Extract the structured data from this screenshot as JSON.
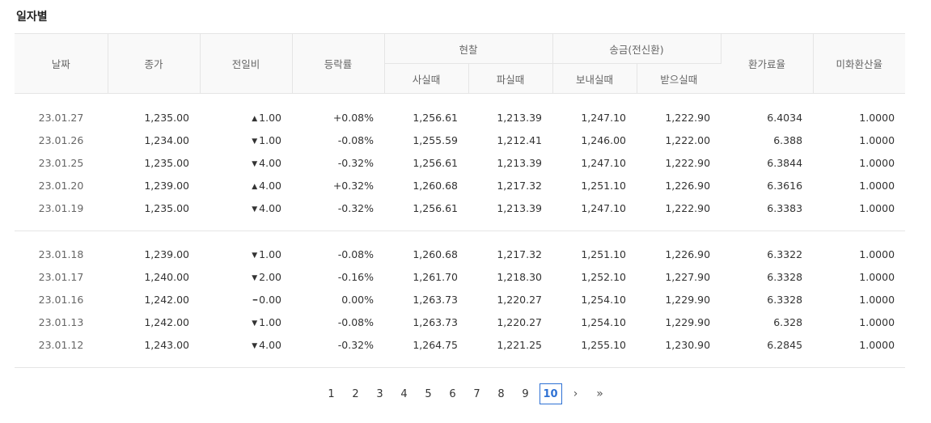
{
  "section_title": "일자별",
  "headers": {
    "date": "날짜",
    "close": "종가",
    "change": "전일비",
    "change_rate": "등락률",
    "cash_group": "현찰",
    "cash_buy": "사실때",
    "cash_sell": "파실때",
    "wire_group": "송금(전신환)",
    "wire_send": "보내실때",
    "wire_receive": "받으실때",
    "fx_rate": "환가료율",
    "usd_rate": "미화환산율"
  },
  "rows": [
    {
      "date": "23.01.27",
      "close": "1,235.00",
      "dir": "up",
      "arrow": "▲",
      "change": "1.00",
      "rate": "+0.08%",
      "cash_buy": "1,256.61",
      "cash_sell": "1,213.39",
      "wire_send": "1,247.10",
      "wire_receive": "1,222.90",
      "fx_rate": "6.4034",
      "usd_rate": "1.0000"
    },
    {
      "date": "23.01.26",
      "close": "1,234.00",
      "dir": "down",
      "arrow": "▼",
      "change": "1.00",
      "rate": "-0.08%",
      "cash_buy": "1,255.59",
      "cash_sell": "1,212.41",
      "wire_send": "1,246.00",
      "wire_receive": "1,222.00",
      "fx_rate": "6.388",
      "usd_rate": "1.0000"
    },
    {
      "date": "23.01.25",
      "close": "1,235.00",
      "dir": "down",
      "arrow": "▼",
      "change": "4.00",
      "rate": "-0.32%",
      "cash_buy": "1,256.61",
      "cash_sell": "1,213.39",
      "wire_send": "1,247.10",
      "wire_receive": "1,222.90",
      "fx_rate": "6.3844",
      "usd_rate": "1.0000"
    },
    {
      "date": "23.01.20",
      "close": "1,239.00",
      "dir": "up",
      "arrow": "▲",
      "change": "4.00",
      "rate": "+0.32%",
      "cash_buy": "1,260.68",
      "cash_sell": "1,217.32",
      "wire_send": "1,251.10",
      "wire_receive": "1,226.90",
      "fx_rate": "6.3616",
      "usd_rate": "1.0000"
    },
    {
      "date": "23.01.19",
      "close": "1,235.00",
      "dir": "down",
      "arrow": "▼",
      "change": "4.00",
      "rate": "-0.32%",
      "cash_buy": "1,256.61",
      "cash_sell": "1,213.39",
      "wire_send": "1,247.10",
      "wire_receive": "1,222.90",
      "fx_rate": "6.3383",
      "usd_rate": "1.0000"
    },
    {
      "date": "23.01.18",
      "close": "1,239.00",
      "dir": "down",
      "arrow": "▼",
      "change": "1.00",
      "rate": "-0.08%",
      "cash_buy": "1,260.68",
      "cash_sell": "1,217.32",
      "wire_send": "1,251.10",
      "wire_receive": "1,226.90",
      "fx_rate": "6.3322",
      "usd_rate": "1.0000"
    },
    {
      "date": "23.01.17",
      "close": "1,240.00",
      "dir": "down",
      "arrow": "▼",
      "change": "2.00",
      "rate": "-0.16%",
      "cash_buy": "1,261.70",
      "cash_sell": "1,218.30",
      "wire_send": "1,252.10",
      "wire_receive": "1,227.90",
      "fx_rate": "6.3328",
      "usd_rate": "1.0000"
    },
    {
      "date": "23.01.16",
      "close": "1,242.00",
      "dir": "flat",
      "arrow": "━",
      "change": "0.00",
      "rate": "0.00%",
      "cash_buy": "1,263.73",
      "cash_sell": "1,220.27",
      "wire_send": "1,254.10",
      "wire_receive": "1,229.90",
      "fx_rate": "6.3328",
      "usd_rate": "1.0000"
    },
    {
      "date": "23.01.13",
      "close": "1,242.00",
      "dir": "down",
      "arrow": "▼",
      "change": "1.00",
      "rate": "-0.08%",
      "cash_buy": "1,263.73",
      "cash_sell": "1,220.27",
      "wire_send": "1,254.10",
      "wire_receive": "1,229.90",
      "fx_rate": "6.328",
      "usd_rate": "1.0000"
    },
    {
      "date": "23.01.12",
      "close": "1,243.00",
      "dir": "down",
      "arrow": "▼",
      "change": "4.00",
      "rate": "-0.32%",
      "cash_buy": "1,264.75",
      "cash_sell": "1,221.25",
      "wire_send": "1,255.10",
      "wire_receive": "1,230.90",
      "fx_rate": "6.2845",
      "usd_rate": "1.0000"
    }
  ],
  "pagination": {
    "pages": [
      "1",
      "2",
      "3",
      "4",
      "5",
      "6",
      "7",
      "8",
      "9",
      "10"
    ],
    "current": "10",
    "next": "›",
    "last": "»"
  },
  "colors": {
    "up": "#d0021b",
    "down": "#1e56b5",
    "current_page": "#2e71d4"
  }
}
